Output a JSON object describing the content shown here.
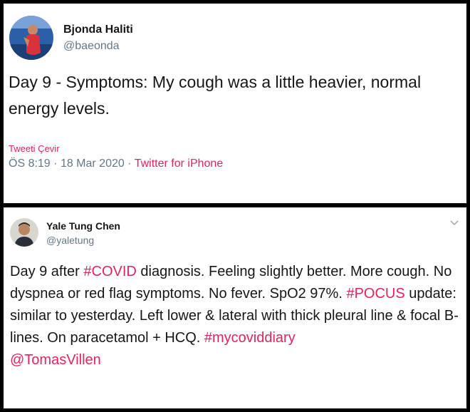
{
  "tweets": [
    {
      "name": "Bjonda Haliti",
      "handle": "@baeonda",
      "text": "Day 9 - Symptoms: My cough was a little heavier, normal energy levels.",
      "translate": "Tweeti Çevir",
      "time": "ÖS 8:19",
      "date": "18 Mar 2020",
      "separator": "·",
      "source": "Twitter for iPhone"
    },
    {
      "name": "Yale Tung Chen",
      "handle": "@yaletung",
      "text": {
        "p1": "Day 9 after ",
        "tag1": "#COVID",
        "p2": " diagnosis. Feeling slightly better. More cough. No dyspnea or red flag symptoms. No fever. SpO2 97%. ",
        "tag2": "#POCUS",
        "p3": " update: similar to yesterday. Left lower & lateral with thick pleural line & focal B-lines. On paracetamol + HCQ. ",
        "tag3": "#mycoviddiary",
        "p4": " ",
        "mention": "@TomasVillen"
      }
    }
  ],
  "colors": {
    "accent": "#e0245e",
    "text": "#14171a",
    "muted": "#657786"
  },
  "icons": {
    "tweet1_avatar": "avatar-photo",
    "tweet2_avatar": "avatar-photo",
    "tweet2_menu": "chevron-down-icon"
  }
}
